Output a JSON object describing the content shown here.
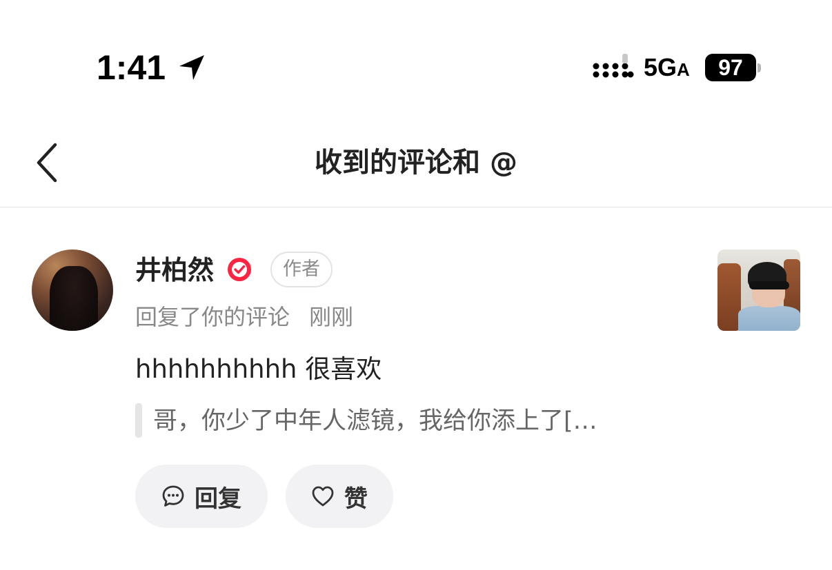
{
  "status_bar": {
    "time": "1:41",
    "network": "5G",
    "network_suffix": "A",
    "battery": "97"
  },
  "nav": {
    "title": "收到的评论和 @"
  },
  "notification": {
    "user_name": "井柏然",
    "author_badge": "作者",
    "action": "回复了你的评论",
    "time": "刚刚",
    "comment": "hhhhhhhhhh 很喜欢",
    "quoted": "哥，你少了中年人滤镜，我给你添上了[…",
    "reply_label": "回复",
    "like_label": "赞"
  },
  "colors": {
    "verified": "#ff2442",
    "button_bg": "#f2f2f4",
    "secondary_text": "#888888"
  },
  "icons": [
    "location-arrow-icon",
    "signal-icon",
    "back-chevron-icon",
    "verified-check-icon",
    "comment-bubble-icon",
    "heart-icon"
  ]
}
